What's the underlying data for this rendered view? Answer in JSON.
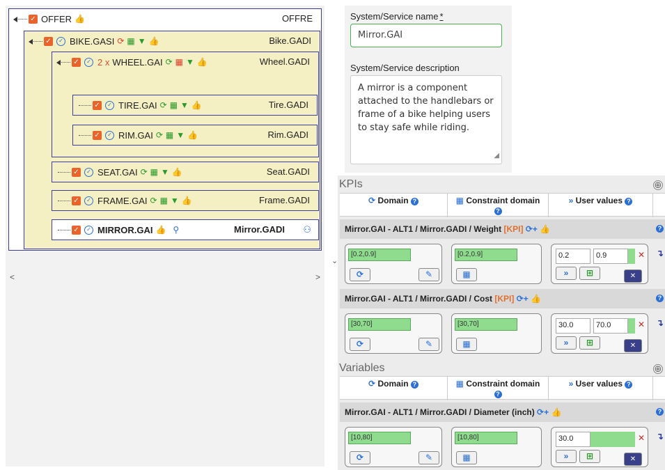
{
  "tree": {
    "nodes": [
      {
        "label": "OFFER",
        "code": "OFFRE"
      },
      {
        "label": "BIKE.GASI",
        "code": "Bike.GADI"
      },
      {
        "qty": "2 x",
        "label": "WHEEL.GAI",
        "code": "Wheel.GADI"
      },
      {
        "label": "TIRE.GAI",
        "code": "Tire.GADI"
      },
      {
        "label": "RIM.GAI",
        "code": "Rim.GADI"
      },
      {
        "label": "SEAT.GAI",
        "code": "Seat.GADI"
      },
      {
        "label": "FRAME.GAI",
        "code": "Frame.GADI"
      },
      {
        "label": "MIRROR.GAI",
        "code": "Mirror.GADI"
      }
    ],
    "scroll_left": "<",
    "scroll_right": ">",
    "scroll_down": "⌄"
  },
  "form": {
    "name_label": "System/Service name",
    "required_mark": "*",
    "name_value": "Mirror.GAI",
    "desc_label": "System/Service description",
    "desc_value": "A mirror is a component attached to the handlebars or frame of a bike helping users to stay safe while riding."
  },
  "kpis": {
    "section_title": "KPIs",
    "section_toggle": "⊕",
    "headers": {
      "domain": "Domain",
      "constraint": "Constraint domain",
      "user_values": "User values"
    },
    "rows": [
      {
        "title": "Mirror.GAI - ALT1 / Mirror.GADI / Weight",
        "tag": "[KPI]",
        "domain": "[0.2,0.9]",
        "constraint": "[0.2,0.9]",
        "uv_min": "0.2",
        "uv_max": "0.9"
      },
      {
        "title": "Mirror.GAI - ALT1 / Mirror.GADI / Cost",
        "tag": "[KPI]",
        "domain": "[30,70]",
        "constraint": "[30,70]",
        "uv_min": "30.0",
        "uv_max": "70.0"
      }
    ]
  },
  "variables": {
    "section_title": "Variables",
    "section_toggle": "⊕",
    "headers": {
      "domain": "Domain",
      "constraint": "Constraint domain",
      "user_values": "User values"
    },
    "rows": [
      {
        "title": "Mirror.GAI - ALT1 / Mirror.GADI / Diameter (inch)",
        "domain": "[10,80]",
        "constraint": "[10,80]",
        "uv_val": "30.0"
      }
    ]
  },
  "colors": {
    "tree_border": "#3b3f9a",
    "tree_fill": "#f5efc4",
    "accent_blue": "#2a6fd6",
    "field_green": "#8fdc8f",
    "checkbox_orange": "#e9632a"
  }
}
